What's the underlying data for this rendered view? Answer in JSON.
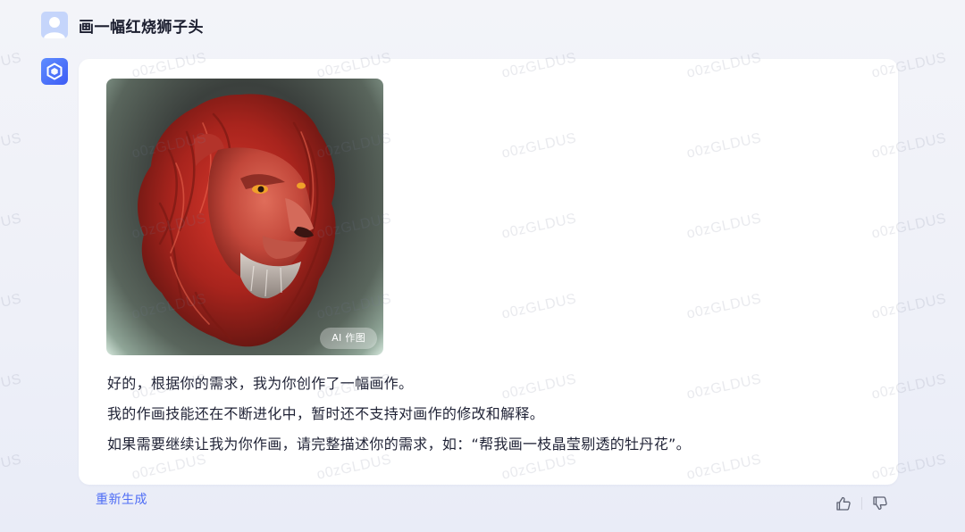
{
  "user_message": {
    "avatar_icon": "user-avatar-icon",
    "text": "画一幅红烧狮子头"
  },
  "bot_message": {
    "avatar_icon": "bot-logo-icon",
    "image": {
      "description_icon": "lion-image",
      "badge": "AI 作图"
    },
    "lines": [
      "好的，根据你的需求，我为你创作了一幅画作。",
      "我的作画技能还在不断进化中，暂时还不支持对画作的修改和解释。",
      "如果需要继续让我为你作画，请完整描述你的需求，如：“帮我画一枝晶莹剔透的牡丹花”。"
    ]
  },
  "actions": {
    "regenerate_label": "重新生成",
    "like_icon": "thumbs-up-icon",
    "dislike_icon": "thumbs-down-icon"
  },
  "watermark": {
    "text": "o0zGLDUS"
  },
  "colors": {
    "accent": "#4f6df5",
    "bot_avatar": "#3d5cf5",
    "user_avatar": "#c5d5fb",
    "text_primary": "#1f2235"
  }
}
